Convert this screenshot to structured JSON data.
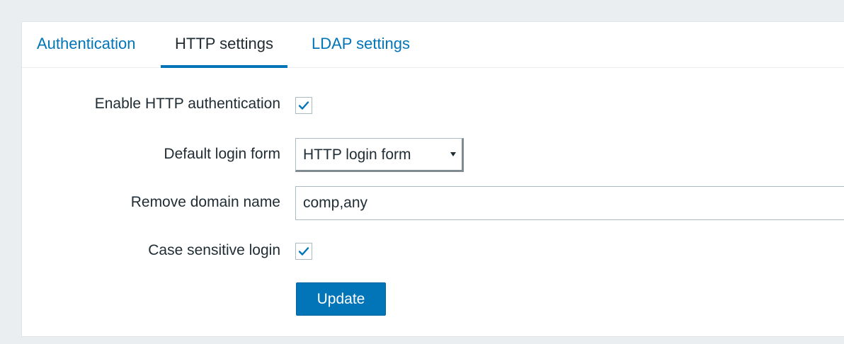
{
  "tabs": [
    {
      "label": "Authentication",
      "active": false
    },
    {
      "label": "HTTP settings",
      "active": true
    },
    {
      "label": "LDAP settings",
      "active": false
    }
  ],
  "form": {
    "enable_http_auth": {
      "label": "Enable HTTP authentication",
      "checked": true
    },
    "default_login_form": {
      "label": "Default login form",
      "value": "HTTP login form"
    },
    "remove_domain_name": {
      "label": "Remove domain name",
      "value": "comp,any"
    },
    "case_sensitive_login": {
      "label": "Case sensitive login",
      "checked": true
    },
    "update_label": "Update"
  },
  "colors": {
    "accent": "#0275b8",
    "background": "#ebeef0",
    "text": "#1f2c33",
    "border": "#acbbc2"
  },
  "icons": {
    "checkmark": "check-icon",
    "dropdown": "caret-down-icon"
  }
}
